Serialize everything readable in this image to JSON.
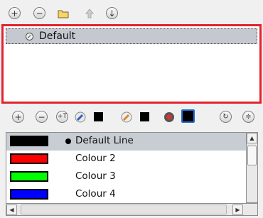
{
  "palette_toolbar": {
    "icons": [
      "add-palette-icon",
      "remove-palette-icon",
      "folder-icon",
      "arrow-up-icon",
      "arrow-down-icon"
    ]
  },
  "palette_list": {
    "items": [
      {
        "label": "Default"
      }
    ]
  },
  "colour_toolbar": {
    "icons": [
      "add-colour-icon",
      "remove-colour-icon",
      "add-texture-icon",
      "eyedropper-icon",
      "fill-swatch-icon",
      "brush-icon",
      "line-swatch-icon",
      "camera-tool-icon",
      "current-colour-icon",
      "link-icon",
      "collapse-icon"
    ]
  },
  "colour_list": {
    "items": [
      {
        "label": "Default Line",
        "color": "#000000"
      },
      {
        "label": "Colour 2",
        "color": "#ff0000"
      },
      {
        "label": "Colour 3",
        "color": "#00ff00"
      },
      {
        "label": "Colour 4",
        "color": "#0000ff"
      }
    ]
  },
  "colors": {
    "accent_border": "#e3222d",
    "selection": "#c5c8cf"
  }
}
